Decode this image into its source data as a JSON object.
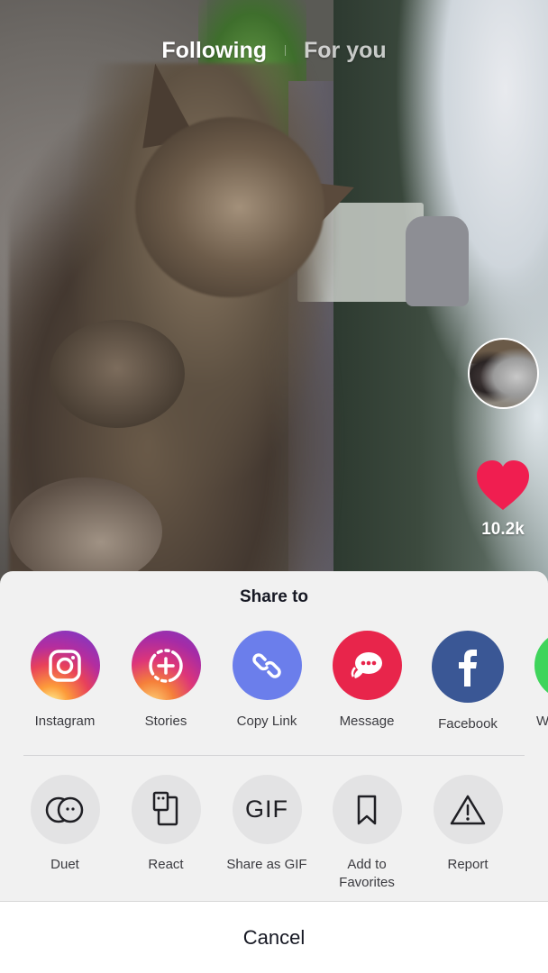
{
  "feed": {
    "tabs": [
      {
        "label": "Following",
        "active": true
      },
      {
        "label": "For you",
        "active": false
      }
    ],
    "like_count": "10.2k",
    "like_color": "#f01e50",
    "avatar_icon": "creator-avatar-kittens"
  },
  "share_sheet": {
    "title": "Share to",
    "share_targets": [
      {
        "label": "Instagram",
        "icon": "instagram-icon",
        "color": "#c13584"
      },
      {
        "label": "Stories",
        "icon": "stories-add-icon",
        "color": "#b52d9e"
      },
      {
        "label": "Copy Link",
        "icon": "link-icon",
        "color": "#6b7eeb"
      },
      {
        "label": "Message",
        "icon": "chat-bubble-icon",
        "color": "#e8254b"
      },
      {
        "label": "Facebook",
        "icon": "facebook-icon",
        "color": "#3a5795"
      },
      {
        "label": "W",
        "icon": "whatsapp-icon",
        "color": "#3fd45b"
      }
    ],
    "actions": [
      {
        "label": "Duet",
        "icon": "duet-icon"
      },
      {
        "label": "React",
        "icon": "react-icon"
      },
      {
        "label": "Share as GIF",
        "icon": "gif-icon",
        "glyph": "GIF"
      },
      {
        "label": "Add to Favorites",
        "line1": "Add to",
        "line2": "Favorites",
        "icon": "bookmark-icon"
      },
      {
        "label": "Report",
        "icon": "warning-icon"
      }
    ],
    "cancel_label": "Cancel"
  }
}
